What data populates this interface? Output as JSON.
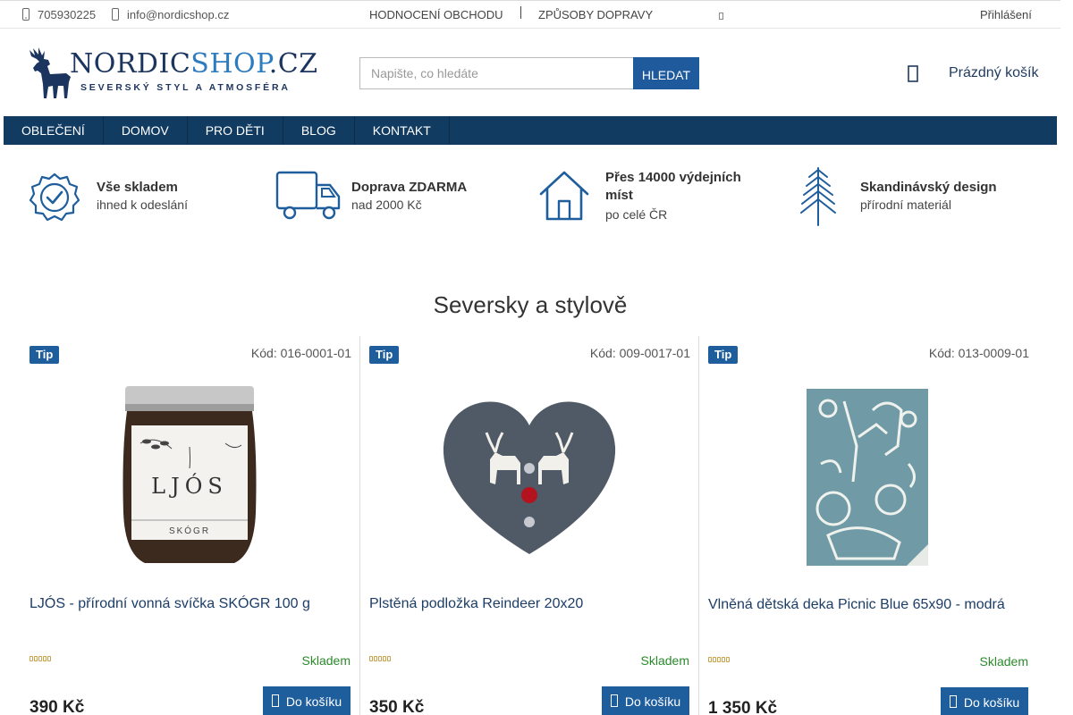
{
  "topbar": {
    "phone": "705930225",
    "email": "info@nordicshop.cz",
    "links": [
      "HODNOCENÍ OBCHODU",
      "ZPŮSOBY DOPRAVY"
    ],
    "login": "Přihlášení"
  },
  "header": {
    "logo_word_a": "NORDIC",
    "logo_word_b": "SHOP",
    "logo_word_c": ".CZ",
    "logo_tagline": "SEVERSKÝ STYL A ATMOSFÉRA",
    "search_placeholder": "Napište, co hledáte",
    "search_button": "HLEDAT",
    "cart_label": "Prázdný košík"
  },
  "nav": {
    "items": [
      "OBLEČENÍ",
      "DOMOV",
      "PRO DĚTI",
      "BLOG",
      "KONTAKT"
    ]
  },
  "benefits": [
    {
      "title": "Vše skladem",
      "sub": "ihned k odeslání",
      "icon": "check-badge-icon"
    },
    {
      "title": "Doprava ZDARMA",
      "sub": "nad 2000 Kč",
      "icon": "truck-icon"
    },
    {
      "title": "Přes 14000 výdejních míst",
      "sub": "po celé ČR",
      "icon": "house-icon"
    },
    {
      "title": "Skandinávský design",
      "sub": "přírodní materiál",
      "icon": "fir-tree-icon"
    }
  ],
  "section_title": "Seversky a stylově",
  "products": [
    {
      "tip": "Tip",
      "code": "Kód: 016-0001-01",
      "name": "LJÓS - přírodní vonná svíčka SKÓGR 100 g",
      "stock": "Skladem",
      "price": "390 Kč",
      "buy": "Do košíku",
      "jar_brand": "LJÓS",
      "jar_scent": "SKÓGR"
    },
    {
      "tip": "Tip",
      "code": "Kód: 009-0017-01",
      "name": "Plstěná podložka Reindeer 20x20",
      "stock": "Skladem",
      "price": "350 Kč",
      "buy": "Do košíku"
    },
    {
      "tip": "Tip",
      "code": "Kód: 013-0009-01",
      "name": "Vlněná dětská deka Picnic Blue 65x90 - modrá",
      "stock": "Skladem",
      "price": "1 350 Kč",
      "buy": "Do košíku"
    }
  ],
  "colors": {
    "brand_navy": "#123b62",
    "brand_blue": "#1f5e9c",
    "stock_green": "#2b8a2b"
  }
}
